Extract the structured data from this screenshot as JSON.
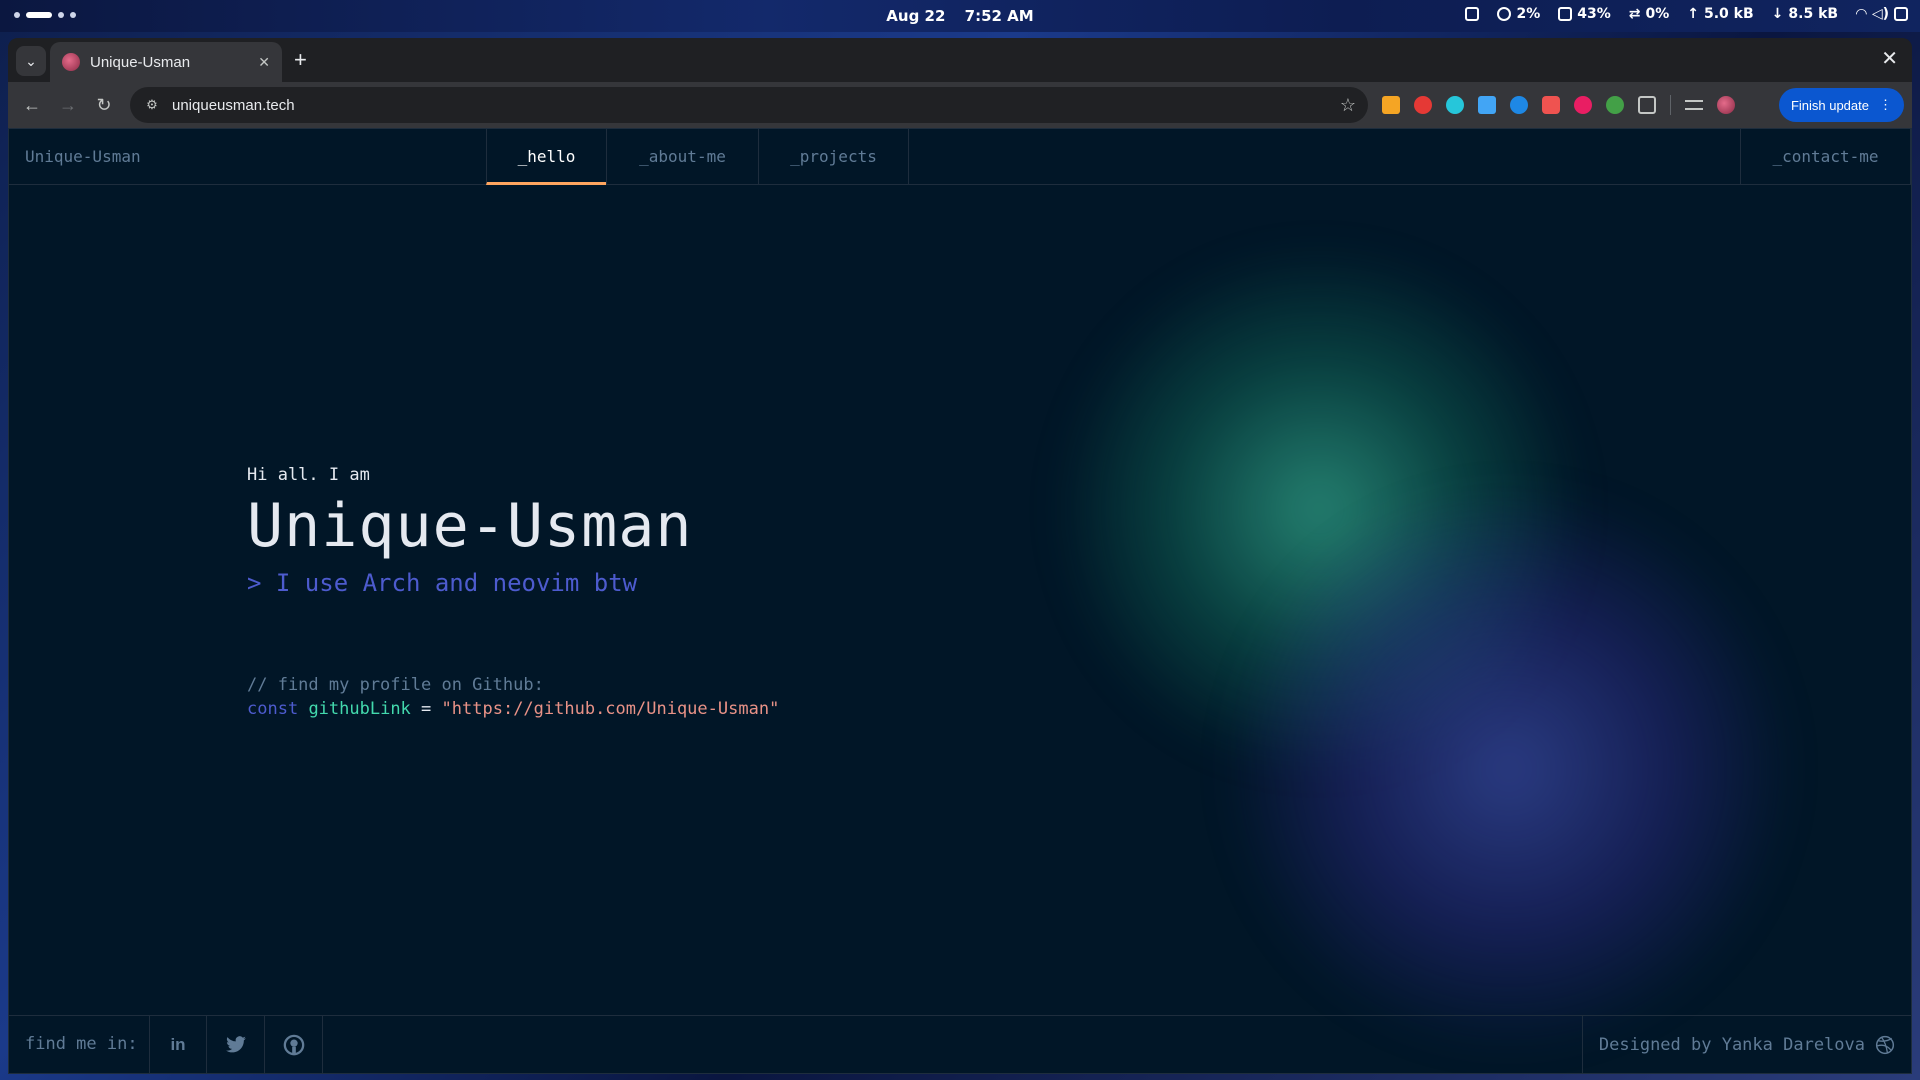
{
  "system": {
    "date": "Aug 22",
    "time": "7:52 AM",
    "cpu": "2%",
    "memory": "43%",
    "swap": "0%",
    "upload": "5.0 kB",
    "download": "8.5 kB"
  },
  "browser": {
    "tab_title": "Unique-Usman",
    "url": "uniqueusman.tech",
    "finish_update": "Finish update"
  },
  "site": {
    "logo": "Unique-Usman",
    "nav": {
      "hello": "_hello",
      "about": "_about-me",
      "projects": "_projects",
      "contact": "_contact-me"
    },
    "hero": {
      "greeting": "Hi all. I am",
      "name": "Unique-Usman",
      "tagline": "> I use Arch and neovim btw",
      "comment": "// find my profile on Github:",
      "keyword": "const",
      "variable": "githubLink",
      "operator": "=",
      "link": "\"https://github.com/Unique-Usman\""
    },
    "footer": {
      "find_me": "find me in:",
      "linkedin": "in",
      "credit": "Designed by Yanka Darelova"
    },
    "colors": {
      "background": "#011627",
      "accent": "#fea55f",
      "green": "#43d9ad",
      "purple": "#4d5bce",
      "string": "#e99287"
    }
  }
}
